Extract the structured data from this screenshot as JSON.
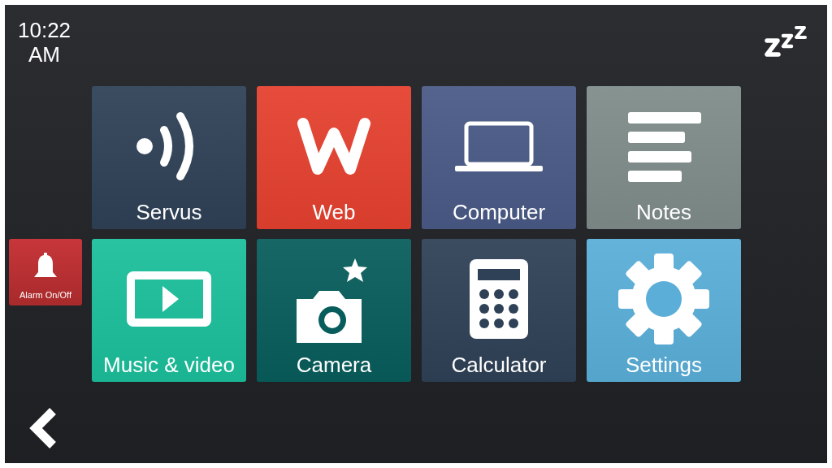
{
  "clock": {
    "time": "10:22",
    "period": "AM"
  },
  "alarm_button": {
    "label": "Alarm On/Off"
  },
  "tiles": [
    {
      "label": "Servus",
      "kind": "signal",
      "color": "#2f4157"
    },
    {
      "label": "Web",
      "kind": "web",
      "color": "#e5412f"
    },
    {
      "label": "Computer",
      "kind": "laptop",
      "color": "#4a5a86"
    },
    {
      "label": "Notes",
      "kind": "notes",
      "color": "#7f8c8a"
    },
    {
      "label": "Music & video",
      "kind": "play",
      "color": "#1bbf9b"
    },
    {
      "label": "Camera",
      "kind": "camera",
      "color": "#075d5b"
    },
    {
      "label": "Calculator",
      "kind": "calculator",
      "color": "#2f4157"
    },
    {
      "label": "Settings",
      "kind": "gear",
      "color": "#5aaed8"
    }
  ]
}
